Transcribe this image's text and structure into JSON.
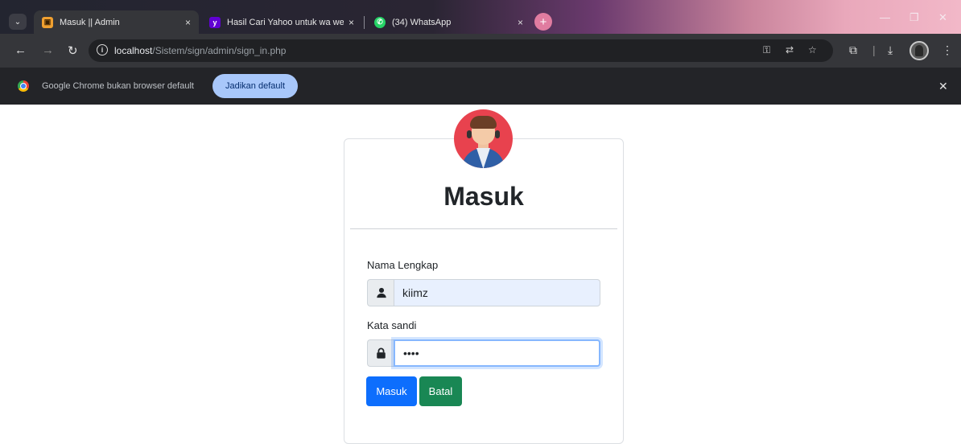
{
  "browser": {
    "tabs": [
      {
        "title": "Masuk || Admin",
        "favicon": "admin-favicon",
        "favicon_color": "#f0a030",
        "active": true
      },
      {
        "title": "Hasil Cari Yahoo untuk wa web",
        "favicon": "yahoo-favicon",
        "favicon_color": "#6001d2",
        "active": false
      },
      {
        "title": "(34) WhatsApp",
        "favicon": "whatsapp-favicon",
        "favicon_color": "#25d366",
        "active": false
      }
    ],
    "close_glyph": "×",
    "new_tab_glyph": "+",
    "address": {
      "host": "localhost",
      "path": "/Sistem/sign/admin/sign_in.php"
    },
    "infobar": {
      "message": "Google Chrome bukan browser default",
      "button": "Jadikan default"
    }
  },
  "page": {
    "title": "Masuk",
    "fields": {
      "name": {
        "label": "Nama Lengkap",
        "value": "kiimz",
        "icon": "user-icon"
      },
      "password": {
        "label": "Kata sandi",
        "value": "••••",
        "icon": "lock-icon"
      }
    },
    "buttons": {
      "submit": "Masuk",
      "cancel": "Batal"
    },
    "colors": {
      "primary": "#0d6efd",
      "success": "#198754",
      "autofill": "#e8f0fe"
    }
  }
}
